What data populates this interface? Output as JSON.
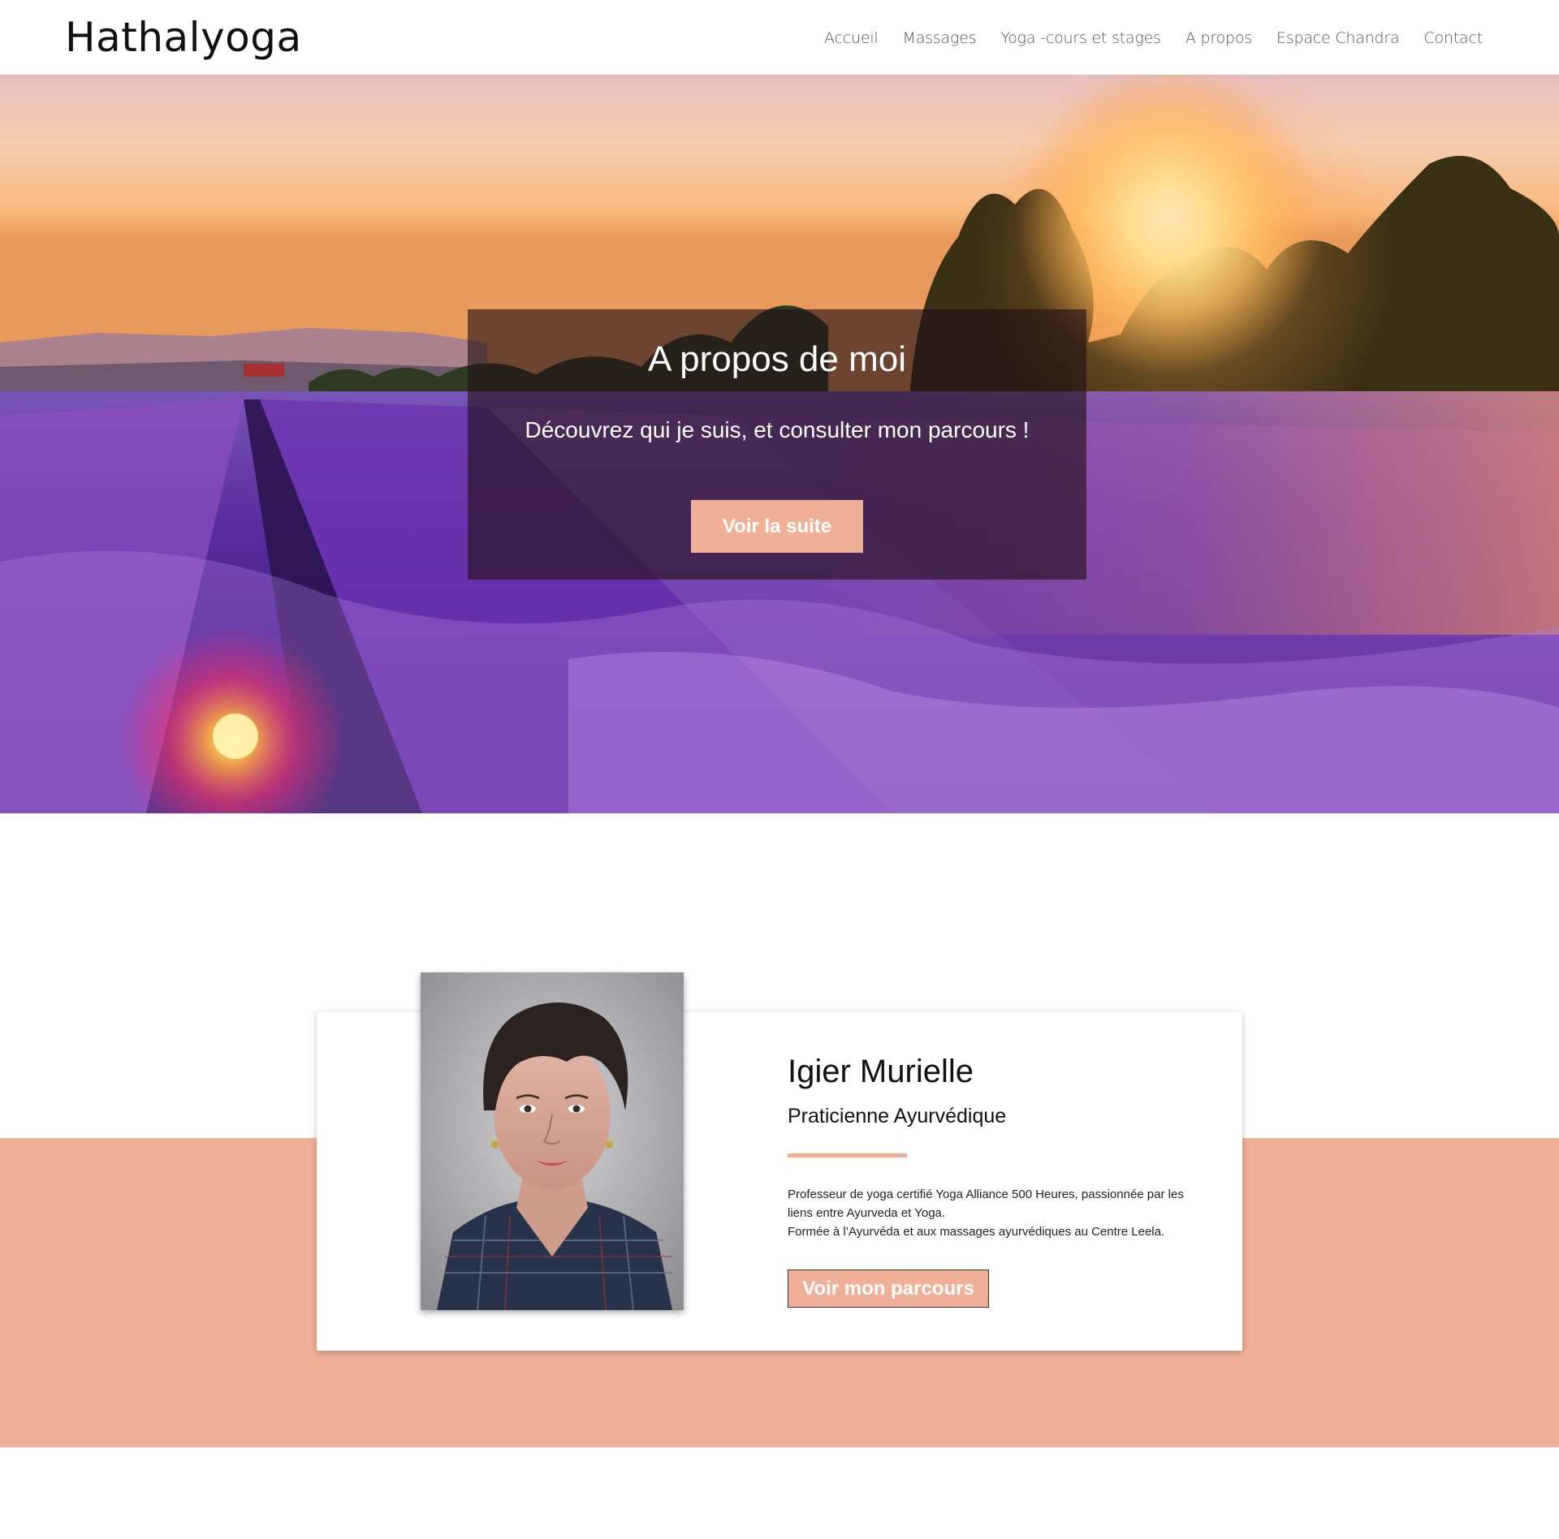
{
  "header": {
    "brand": "Hathalyoga",
    "nav": [
      {
        "label": "Accueil"
      },
      {
        "label": "Massages"
      },
      {
        "label": "Yoga -cours et stages"
      },
      {
        "label": "A propos"
      },
      {
        "label": "Espace Chandra"
      },
      {
        "label": "Contact"
      }
    ]
  },
  "hero": {
    "title": "A propos de moi",
    "subtitle": "Découvrez qui je suis, et consulter mon parcours !",
    "button_label": "Voir la suite"
  },
  "profile": {
    "name": "Igier Murielle",
    "role": "Praticienne Ayurvédique",
    "description": [
      "Professeur de yoga certifié Yoga Alliance 500 Heures, passionnée par les liens entre Ayurveda et Yoga.",
      "Formée à l’Ayurvéda et aux massages ayurvédiques au Centre Leela."
    ],
    "button_label": "Voir mon parcours"
  },
  "colors": {
    "accent": "#f0b098",
    "overlay": "#201014",
    "text_dark": "#111111",
    "nav_text": "#555555"
  }
}
